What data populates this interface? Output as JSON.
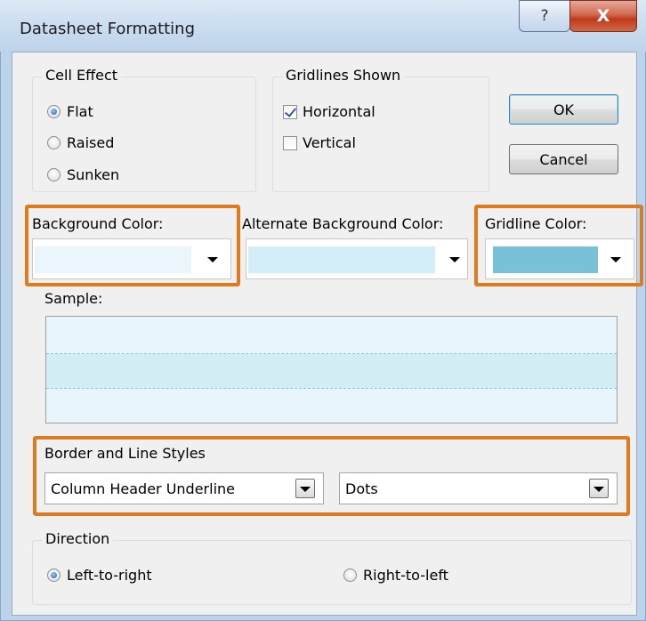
{
  "window": {
    "title": "Datasheet Formatting",
    "help_glyph": "?",
    "close_glyph": "X"
  },
  "cell_effect": {
    "legend": "Cell Effect",
    "options": [
      {
        "label": "Flat",
        "selected": true
      },
      {
        "label": "Raised",
        "selected": false
      },
      {
        "label": "Sunken",
        "selected": false
      }
    ]
  },
  "gridlines": {
    "legend": "Gridlines Shown",
    "options": [
      {
        "label": "Horizontal",
        "checked": true
      },
      {
        "label": "Vertical",
        "checked": false
      }
    ]
  },
  "buttons": {
    "ok": "OK",
    "cancel": "Cancel"
  },
  "colors": {
    "background": {
      "label": "Background Color:",
      "value": "#eaf6fb"
    },
    "alternate": {
      "label": "Alternate Background Color:",
      "value": "#d3eef6"
    },
    "gridline": {
      "label": "Gridline Color:",
      "value": "#78c1d6"
    }
  },
  "sample": {
    "label": "Sample:",
    "row_color": "#e8f6fb",
    "alt_row_color": "#d3edf5",
    "line_color": "#7fc8dd"
  },
  "border_styles": {
    "legend": "Border and Line Styles",
    "element": "Column Header Underline",
    "style": "Dots"
  },
  "direction": {
    "legend": "Direction",
    "options": [
      {
        "label": "Left-to-right",
        "selected": true
      },
      {
        "label": "Right-to-left",
        "selected": false
      }
    ]
  },
  "highlight_color": "#e07a1f"
}
